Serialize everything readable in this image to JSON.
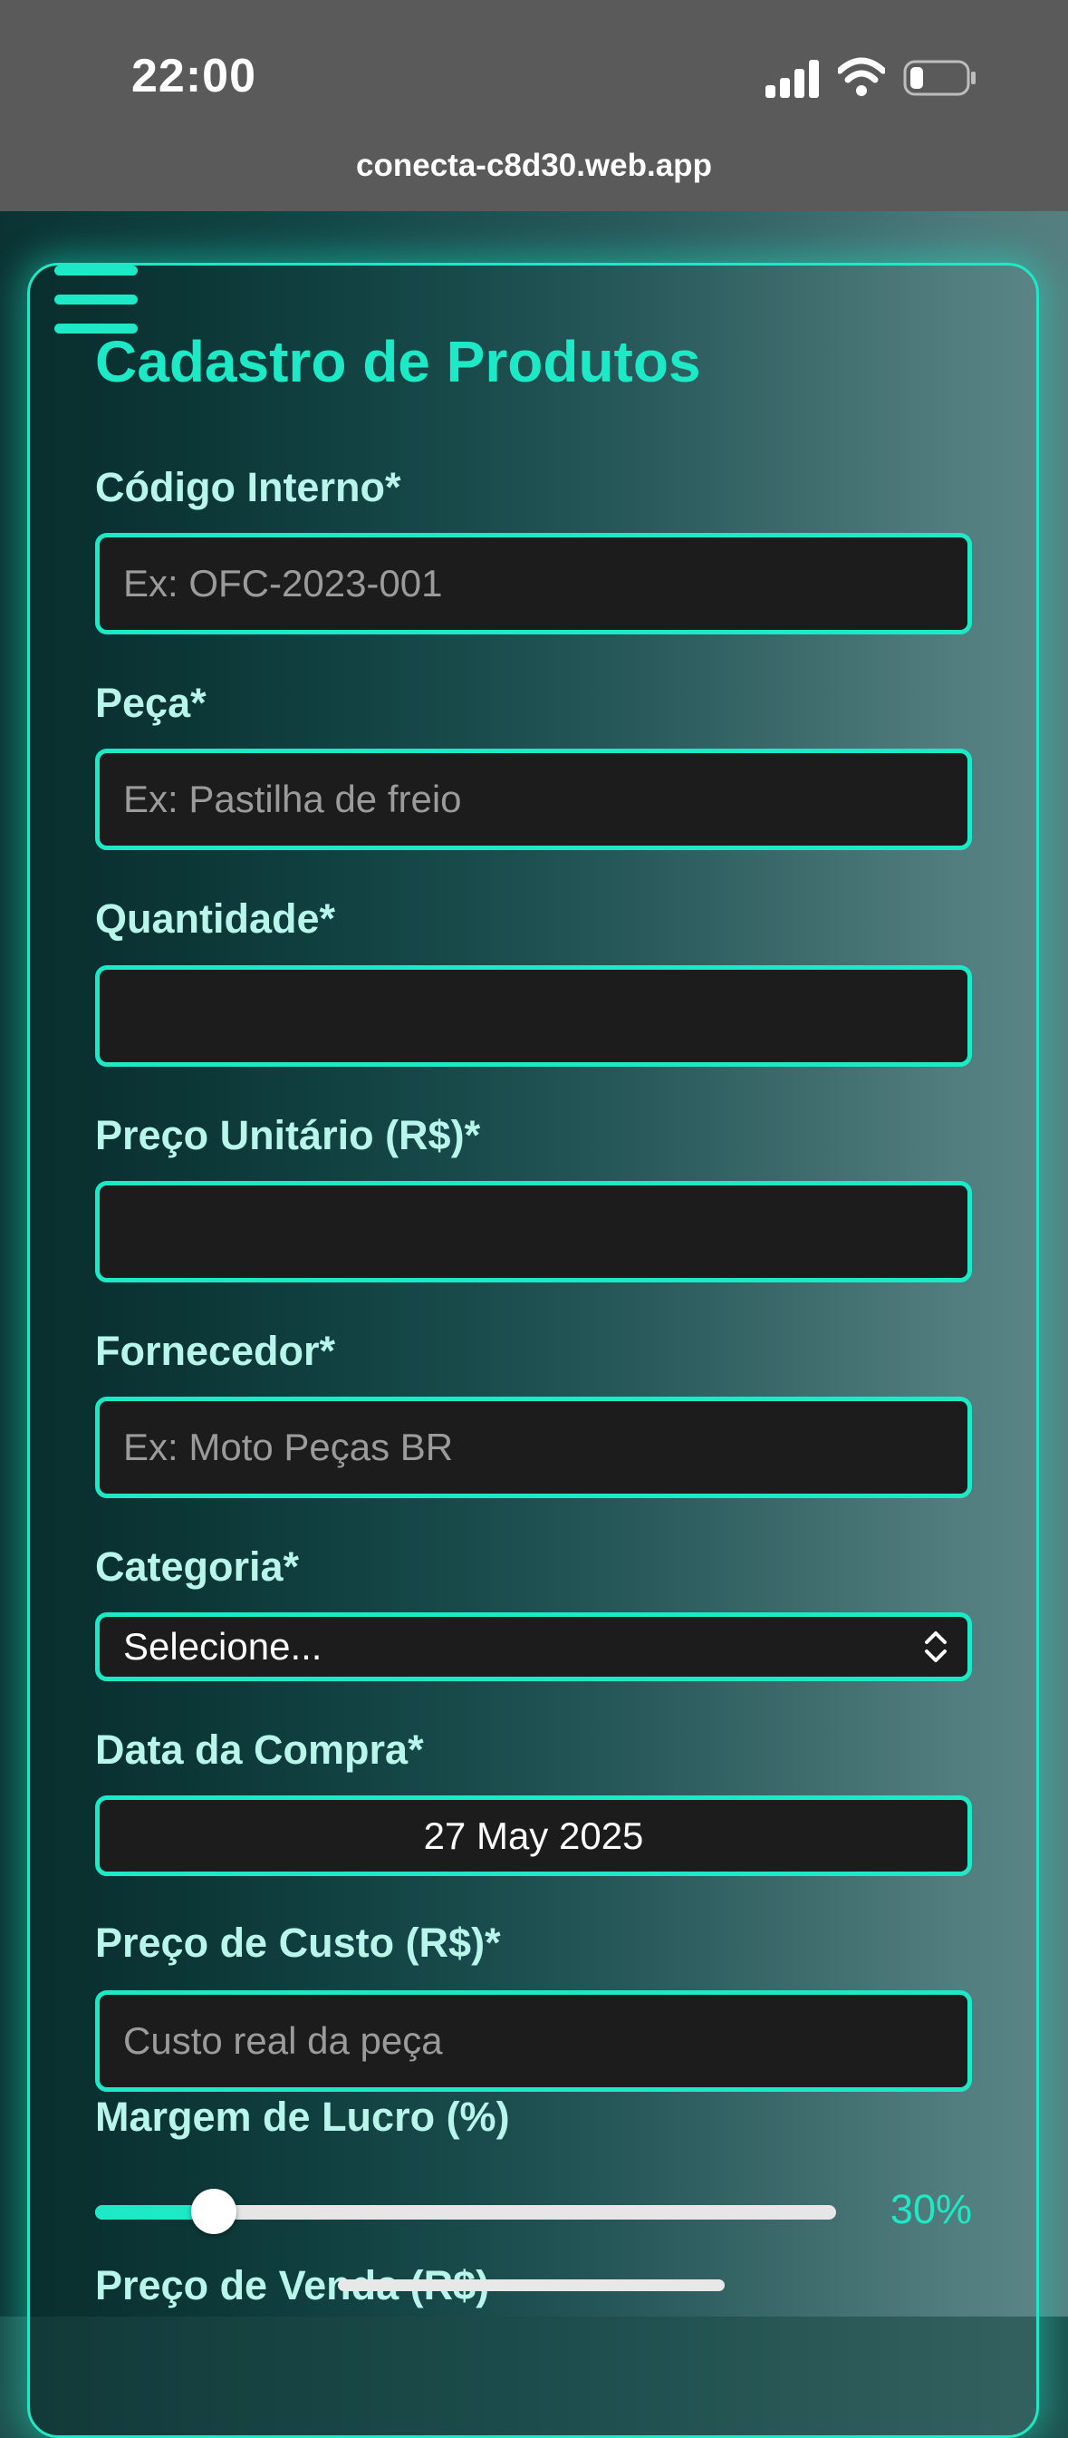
{
  "status_bar": {
    "time": "22:00",
    "url": "conecta-c8d30.web.app"
  },
  "page": {
    "title": "Cadastro de Produtos"
  },
  "form": {
    "codigo": {
      "label": "Código Interno*",
      "placeholder": "Ex: OFC-2023-001"
    },
    "peca": {
      "label": "Peça*",
      "placeholder": "Ex: Pastilha de freio"
    },
    "quantidade": {
      "label": "Quantidade*",
      "value": ""
    },
    "preco_unitario": {
      "label": "Preço Unitário (R$)*",
      "value": ""
    },
    "fornecedor": {
      "label": "Fornecedor*",
      "placeholder": "Ex: Moto Peças BR"
    },
    "categoria": {
      "label": "Categoria*",
      "selected": "Selecione..."
    },
    "data_compra": {
      "label": "Data da Compra*",
      "value": "27 May 2025"
    },
    "preco_custo": {
      "label": "Preço de Custo (R$)*",
      "placeholder": "Custo real da peça"
    },
    "margem": {
      "label": "Margem de Lucro (%)",
      "value_text": "30%",
      "level": 0.16
    },
    "preco_venda": {
      "label": "Preço de Venda (R$)"
    }
  },
  "colors": {
    "accent": "#1de9c6",
    "field_bg": "#1c1c1c",
    "label": "#b8f5ea",
    "status_bar": "#5a5a5a"
  },
  "icons": [
    "menu-icon",
    "signal-icon",
    "wifi-icon",
    "battery-icon",
    "chevron-updown-icon"
  ]
}
